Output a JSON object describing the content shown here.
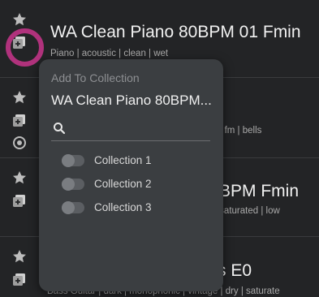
{
  "rows": [
    {
      "title": "WA Clean Piano 80BPM 01 Fmin",
      "tags": "Piano | acoustic | clean | wet"
    },
    {
      "title": "",
      "tags": "t | fm | bells"
    },
    {
      "title": "BPM Fmin",
      "tags": "| saturated | low"
    },
    {
      "title": "s E0",
      "tags": "Bass Guitar | dark | monophonic | vintage | dry | saturate"
    }
  ],
  "popup": {
    "header": "Add To Collection",
    "item_name": "WA Clean Piano 80BPM...",
    "search_value": "",
    "collections": [
      {
        "label": "Collection 1",
        "enabled": false
      },
      {
        "label": "Collection 2",
        "enabled": false
      },
      {
        "label": "Collection 3",
        "enabled": false
      }
    ]
  },
  "colors": {
    "highlight_ring": "#b0327c",
    "background": "#1b1c1e",
    "popup": "#3b3e41"
  }
}
